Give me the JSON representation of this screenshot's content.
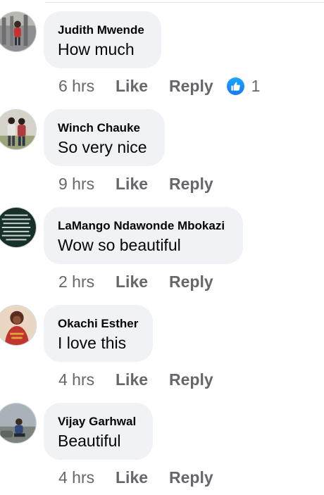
{
  "comments": [
    {
      "author": "Judith Mwende",
      "text": "How much",
      "time": "6 hrs",
      "like": "Like",
      "reply": "Reply",
      "reaction_count": "1",
      "reaction_icon": "thumbs-up-icon"
    },
    {
      "author": "Winch Chauke",
      "text": "So very nice",
      "time": "9 hrs",
      "like": "Like",
      "reply": "Reply"
    },
    {
      "author": "LaMango Ndawonde Mbokazi",
      "text": "Wow so beautiful",
      "time": "2 hrs",
      "like": "Like",
      "reply": "Reply"
    },
    {
      "author": "Okachi Esther",
      "text": "I love this",
      "time": "4 hrs",
      "like": "Like",
      "reply": "Reply"
    },
    {
      "author": "Vijay Garhwal",
      "text": "Beautiful",
      "time": "4 hrs",
      "like": "Like",
      "reply": "Reply"
    }
  ],
  "colors": {
    "bubble": "#f0f2f5",
    "name": "#050505",
    "meta": "#65676b",
    "like_badge": "#1877f2"
  }
}
